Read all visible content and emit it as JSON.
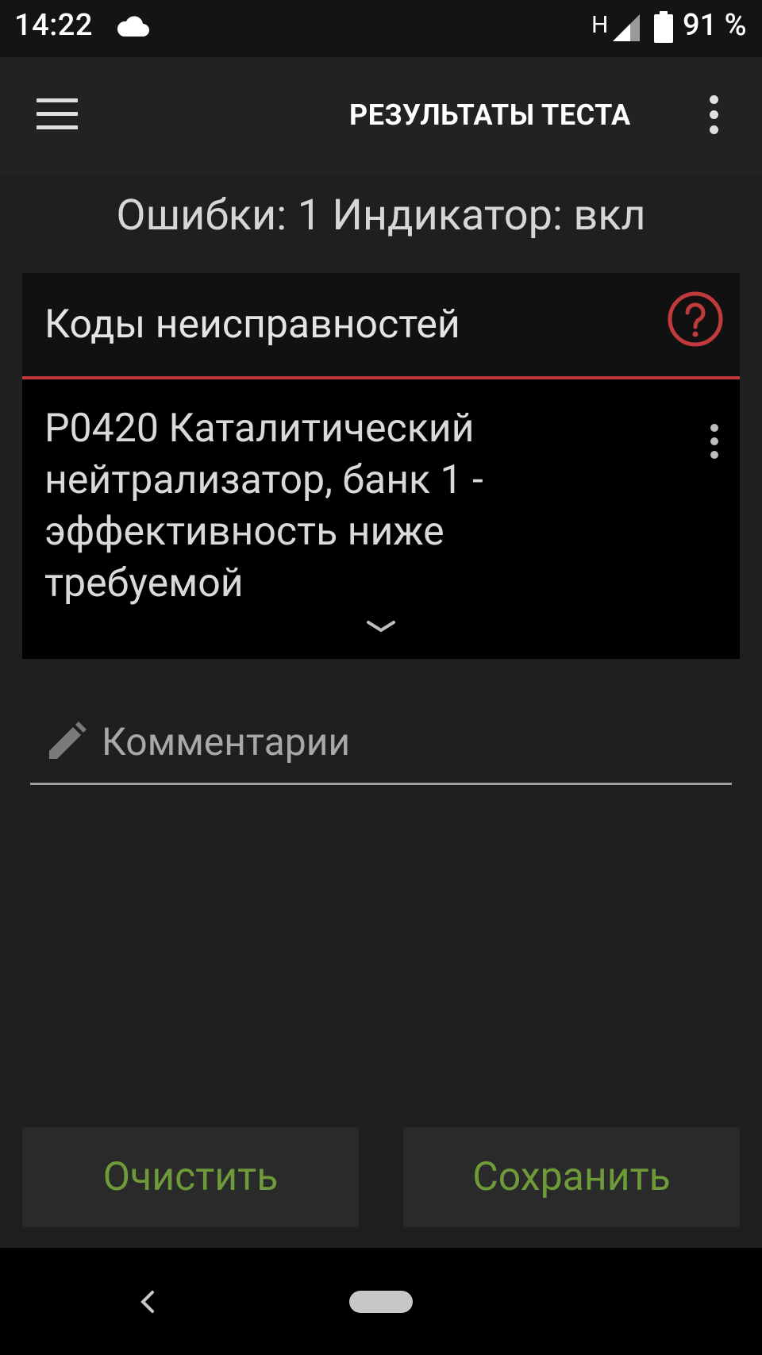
{
  "status_bar": {
    "time": "14:22",
    "network_type": "H",
    "battery_percent": "91 %",
    "icons": [
      "cloud-icon",
      "signal-icon",
      "battery-icon"
    ]
  },
  "app_bar": {
    "title": "РЕЗУЛЬТАТЫ ТЕСТА",
    "icons": [
      "menu-icon",
      "overflow-menu-icon"
    ]
  },
  "summary": {
    "text": "Ошибки: 1 Индикатор: вкл"
  },
  "dtc_card": {
    "title": "Коды неисправностей",
    "help_icon": "help-icon",
    "items": [
      {
        "text": "P0420 Каталитический нейтрализатор, банк 1 - эффективность ниже требуемой"
      }
    ],
    "expand_icon": "chevron-down-icon"
  },
  "comment": {
    "placeholder": "Комментарии",
    "value": "",
    "icon": "pencil-icon"
  },
  "buttons": {
    "clear_label": "Очистить",
    "save_label": "Сохранить"
  },
  "colors": {
    "background": "#1f1f1f",
    "accent_red": "#c0393b",
    "button_text_green": "#6f9a3a",
    "card_background": "#000000"
  }
}
